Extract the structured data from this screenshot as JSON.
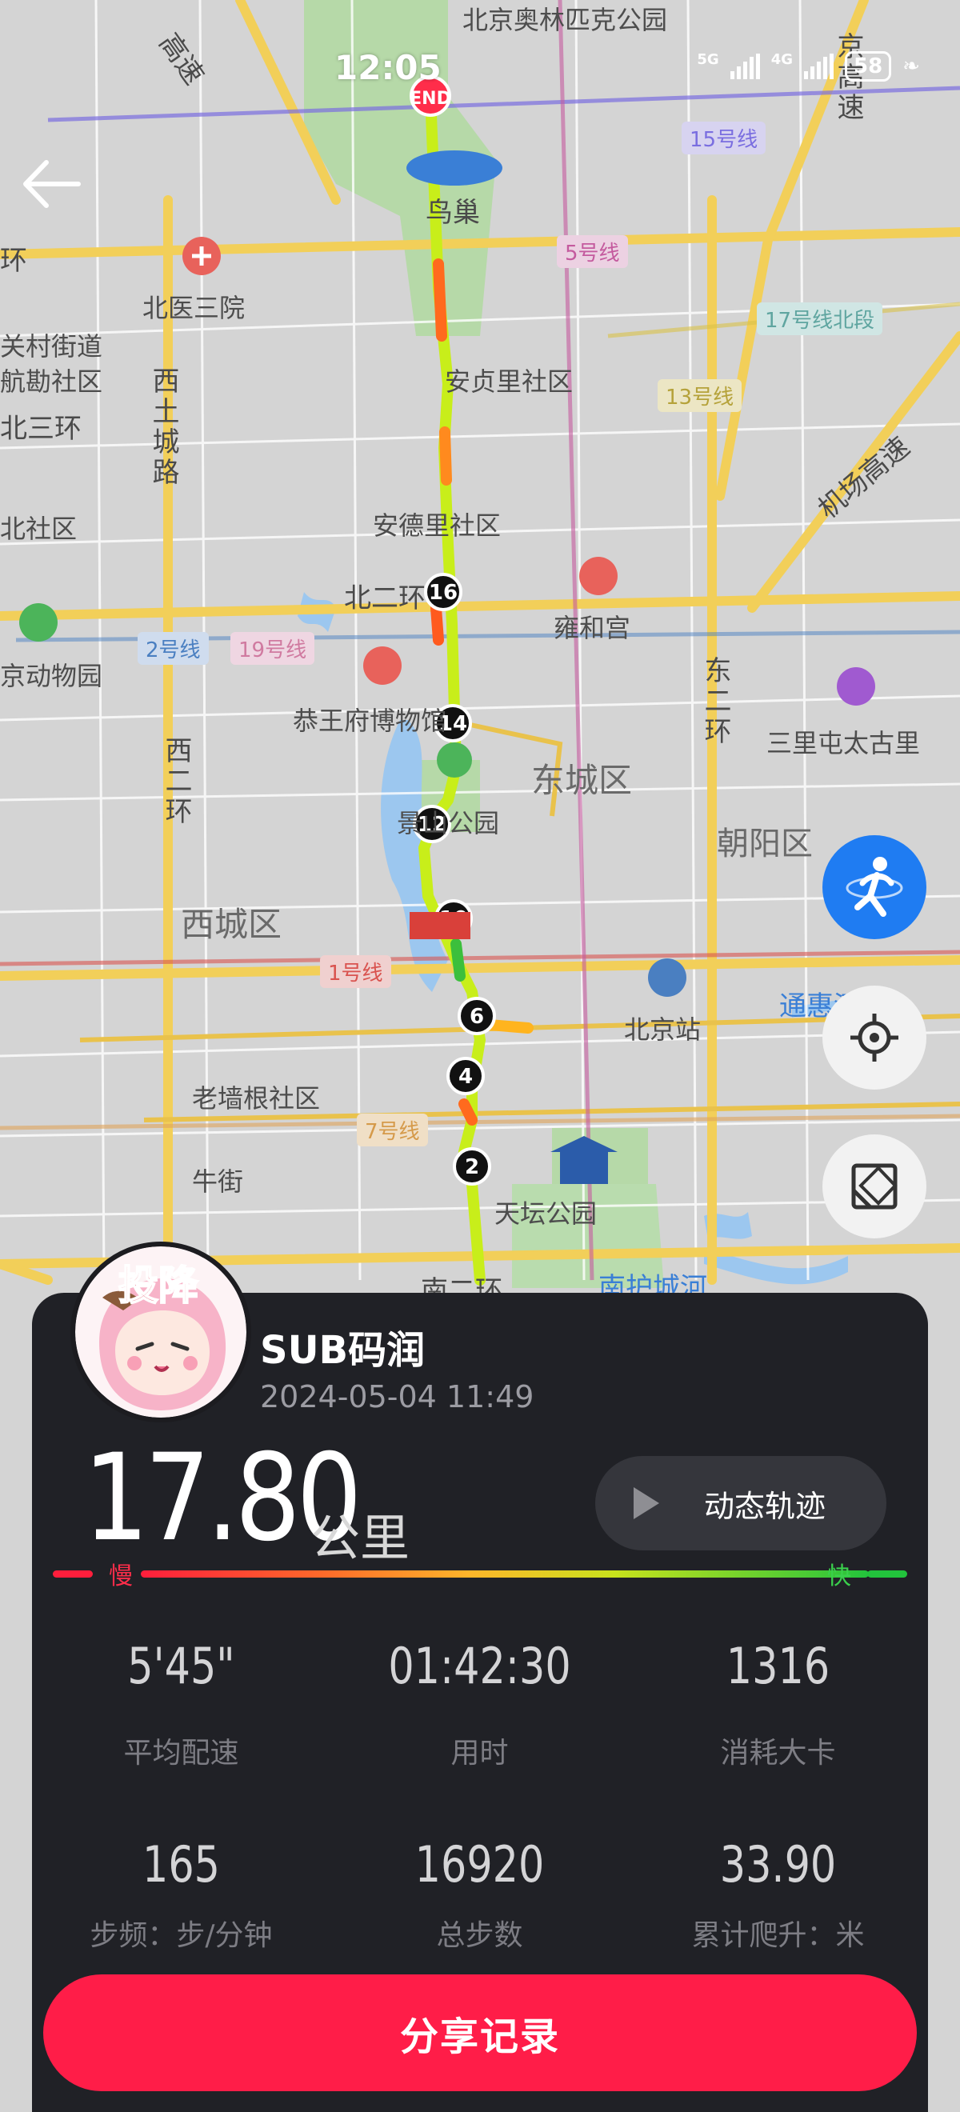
{
  "status_bar": {
    "time": "12:05",
    "network_1": "5G",
    "network_2": "4G",
    "battery": "58"
  },
  "map": {
    "labels": [
      "北京奥林匹克公园",
      "鸟巢",
      "北医三院",
      "西土城路",
      "北三环",
      "安贞里社区",
      "安德里社区",
      "北二环",
      "雍和宫",
      "恭王府博物馆",
      "东城区",
      "景山公园",
      "西城区",
      "北京站",
      "老墙根社区",
      "牛街",
      "天坛公园",
      "南二环",
      "南护城河",
      "东二环",
      "西二环",
      "三里屯太古里",
      "朝阳区",
      "机场高速",
      "京动物园",
      "关村街道",
      "航勘社区",
      "北社区",
      "通惠河",
      "京高速",
      "高速",
      "环"
    ],
    "metro_tags": [
      "15号线",
      "5号线",
      "17号线北段",
      "13号线",
      "2号线",
      "19号线",
      "1号线",
      "7号线"
    ],
    "markers": {
      "end": "END",
      "km": [
        "16",
        "14",
        "12",
        "10",
        "6",
        "4",
        "2"
      ]
    }
  },
  "controls": {
    "back_icon": "arrow-left-icon",
    "run_mode_icon": "runner-icon",
    "locate_icon": "crosshair-icon",
    "layers_icon": "map-layer-icon"
  },
  "card": {
    "avatar_text": "投降",
    "username": "SUB码润",
    "record_time": "2024-05-04 11:49",
    "distance": "17.80",
    "distance_unit": "公里",
    "replay_label": "动态轨迹",
    "pace_slow": "慢",
    "pace_fast": "快",
    "stats": [
      {
        "value": "5'45\"",
        "label": "平均配速"
      },
      {
        "value": "01:42:30",
        "label": "用时"
      },
      {
        "value": "1316",
        "label": "消耗大卡"
      },
      {
        "value": "165",
        "label": "步频：步/分钟"
      },
      {
        "value": "16920",
        "label": "总步数"
      },
      {
        "value": "33.90",
        "label": "累计爬升：米"
      }
    ],
    "share_label": "分享记录"
  },
  "colors": {
    "accent_red": "#ff1d48",
    "fab_blue": "#1f7cf2",
    "card_bg": "#202126"
  }
}
